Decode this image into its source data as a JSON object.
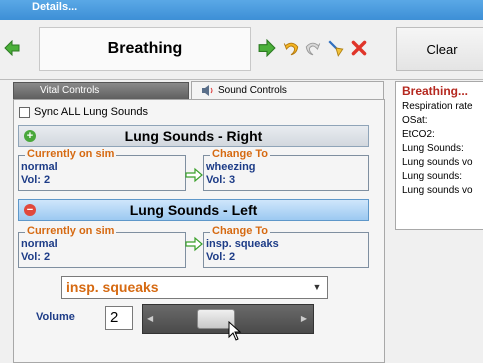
{
  "window": {
    "title": "Details..."
  },
  "toolbar": {
    "section_title": "Breathing",
    "clear_label": "Clear",
    "icons": [
      "back-arrow-icon",
      "forward-arrow-icon",
      "undo-icon",
      "redo-icon",
      "broom-icon",
      "close-icon"
    ]
  },
  "tabs": [
    {
      "label": "Vital Controls",
      "icon": "vital-icon",
      "active": false
    },
    {
      "label": "Sound Controls",
      "icon": "speaker-icon",
      "active": true
    }
  ],
  "sync": {
    "label": "Sync ALL Lung Sounds",
    "checked": false
  },
  "lung_right": {
    "title": "Lung Sounds - Right",
    "current_label": "Currently on sim",
    "current_sound": "normal",
    "current_vol": "Vol: 2",
    "change_label": "Change To",
    "change_sound": "wheezing",
    "change_vol": "Vol: 3"
  },
  "lung_left": {
    "title": "Lung Sounds - Left",
    "current_label": "Currently on sim",
    "current_sound": "normal",
    "current_vol": "Vol: 2",
    "change_label": "Change To",
    "change_sound": "insp. squeaks",
    "change_vol": "Vol: 2"
  },
  "selector": {
    "selected": "insp. squeaks",
    "volume_label": "Volume",
    "volume_value": "2",
    "slider_fraction": 0.38
  },
  "info": {
    "title": "Breathing...",
    "lines": [
      "Respiration rate",
      "OSat:",
      "EtCO2:",
      "Lung Sounds:",
      "Lung sounds vo",
      "Lung sounds:",
      "Lung sounds vo"
    ]
  },
  "colors": {
    "accent_orange": "#d66a12",
    "value_blue": "#1d3c87",
    "info_title_red": "#b5281f",
    "green_arrow": "#3aa02a"
  }
}
